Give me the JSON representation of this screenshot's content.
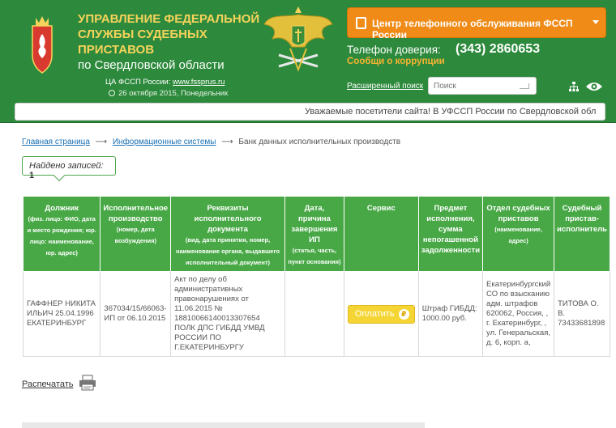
{
  "header": {
    "org_line1": "УПРАВЛЕНИЕ ФЕДЕРАЛЬНОЙ",
    "org_line2": "СЛУЖБЫ СУДЕБНЫХ ПРИСТАВОВ",
    "org_line3": "по Свердловской области",
    "ca_label": "ЦА ФССП России: ",
    "ca_link": "www.fssprus.ru",
    "date": "26 октября 2015, Понедельник",
    "call_center_label": "Центр телефонного обслуживания ФССП России",
    "trust_phone_label": "Телефон доверия:",
    "trust_phone_number": "(343) 2860653",
    "corruption_link": "Сообщи о коррупции",
    "advanced_search": "Расширенный поиск",
    "search_placeholder": "Поиск",
    "ticker": "Уважаемые посетители сайта! В УФССП России по Свердловской обл",
    "icons": [
      "coat-of-arms",
      "fssp-eagle-emblem",
      "phone-icon",
      "clock-icon",
      "sitemap-icon",
      "eye-icon",
      "printer-icon"
    ],
    "colors": {
      "header_green": "#2d8a3c",
      "accent_orange": "#f08b18",
      "title_yellow": "#f6d35b",
      "table_green": "#47a845",
      "pay_yellow": "#f5d534"
    }
  },
  "breadcrumb": {
    "home": "Главная страница",
    "systems": "Информационные системы",
    "current": "Банк данных исполнительных производств",
    "separator": "⟶"
  },
  "results": {
    "found_label": "Найдено записей:",
    "found_count": "1"
  },
  "table": {
    "headers": [
      {
        "title": "Должник",
        "note": "(физ. лицо: ФИО, дата и место рождения; юр. лицо: наименование, юр. адрес)"
      },
      {
        "title": "Исполнительное производство",
        "note": "(номер, дата возбуждения)"
      },
      {
        "title": "Реквизиты исполнительного документа",
        "note": "(вид, дата принятия, номер, наименование органа, выдавшего исполнительный документ)"
      },
      {
        "title": "Дата, причина завершения ИП",
        "note": "(статья, часть, пункт основания)"
      },
      {
        "title": "Сервис",
        "note": ""
      },
      {
        "title": "Предмет исполнения, сумма непогашенной задолженности",
        "note": ""
      },
      {
        "title": "Отдел судебных приставов",
        "note": "(наименование, адрес)"
      },
      {
        "title": "Судебный пристав-исполнитель",
        "note": ""
      }
    ],
    "row": {
      "debtor": "ГАФФНЕР НИКИТА ИЛЬИЧ 25.04.1996 ЕКАТЕРИНБУРГ",
      "proceeding": "367034/15/66063-ИП от 06.10.2015",
      "document": "Акт по делу об административных правонарушениях от 11.06.2015 № 18810066140013307654 ПОЛК ДПС ГИБДД УМВД РОССИИ ПО Г.ЕКАТЕРИНБУРГУ",
      "completion": "",
      "pay_label": "Оплатить",
      "pay_symbol": "₽",
      "subject": "Штраф ГИБДД: 1000.00 руб.",
      "department": "Екатеринбургский СО по взысканию адм. штрафов 620062, Россия, , г. Екатеринбург, , ул. Генеральская, д. 6, корп. а,",
      "bailiff": "ТИТОВА О. В. 73433681898"
    }
  },
  "footer": {
    "print_label": "Распечатать"
  }
}
